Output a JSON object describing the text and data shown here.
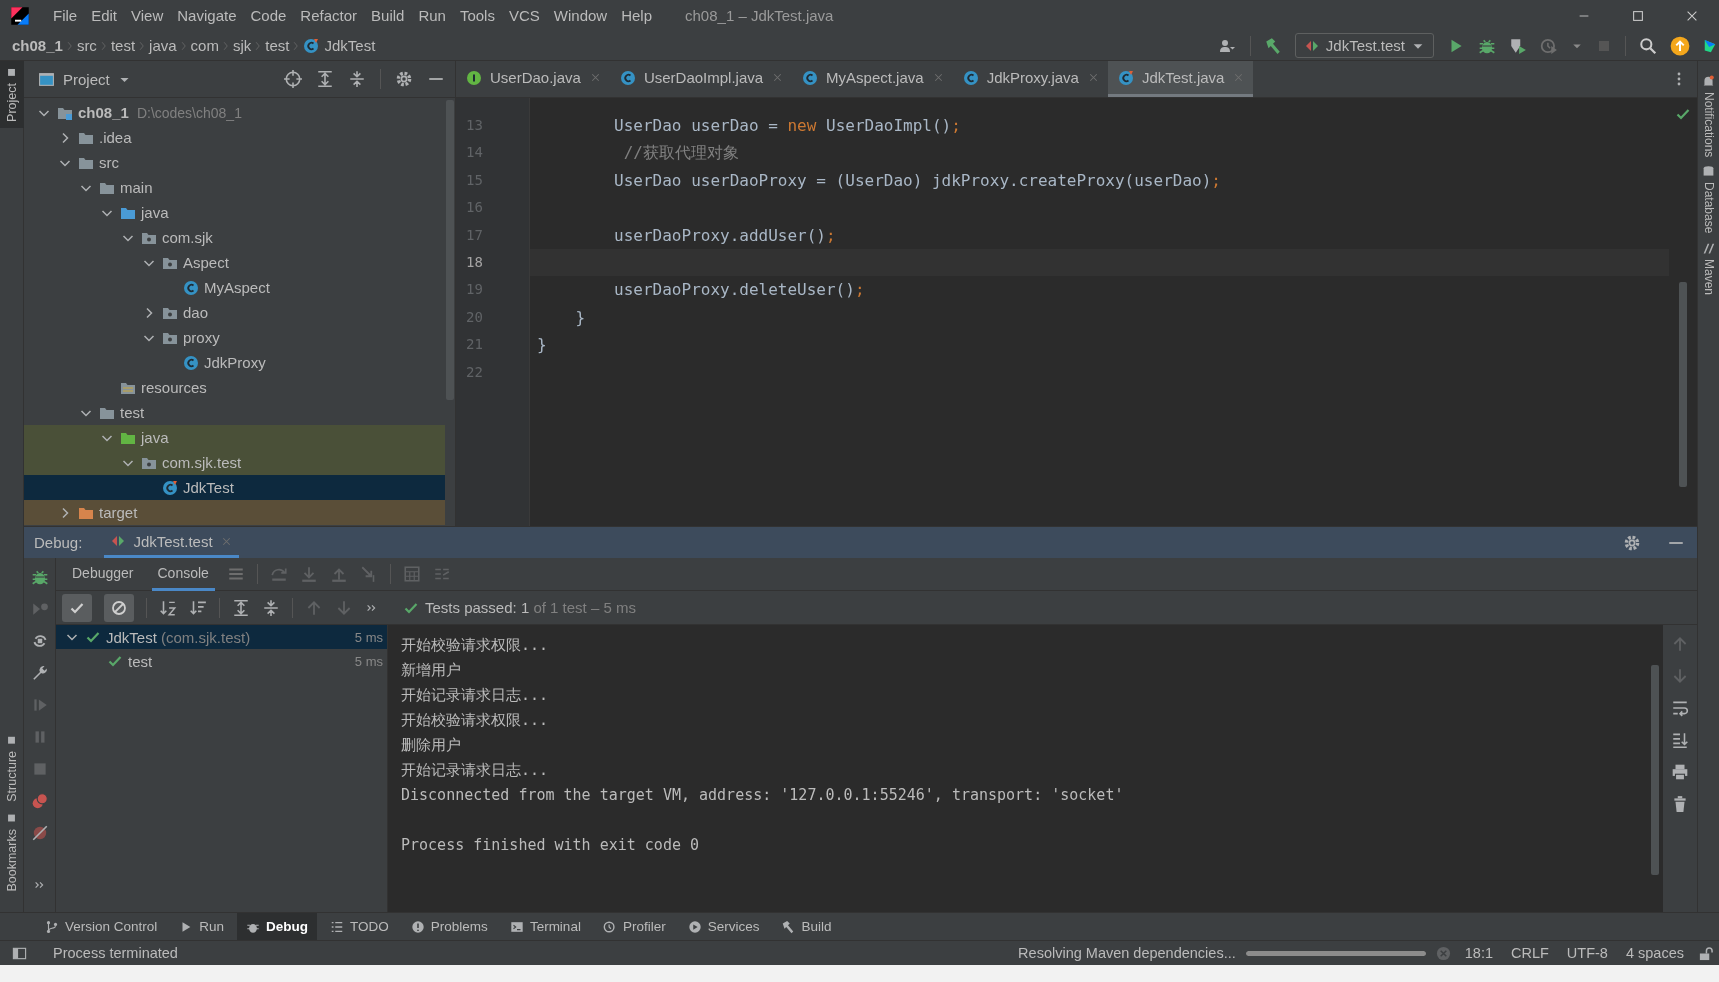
{
  "window": {
    "title": "ch08_1 – JdkTest.java"
  },
  "menu": [
    "File",
    "Edit",
    "View",
    "Navigate",
    "Code",
    "Refactor",
    "Build",
    "Run",
    "Tools",
    "VCS",
    "Window",
    "Help"
  ],
  "breadcrumb": [
    {
      "label": "ch08_1",
      "kind": "project"
    },
    {
      "label": "src",
      "kind": "folder"
    },
    {
      "label": "test",
      "kind": "folder"
    },
    {
      "label": "java",
      "kind": "folder"
    },
    {
      "label": "com",
      "kind": "folder"
    },
    {
      "label": "sjk",
      "kind": "folder"
    },
    {
      "label": "test",
      "kind": "folder"
    },
    {
      "label": "JdkTest",
      "kind": "test-class"
    }
  ],
  "run_config": "JdkTest.test",
  "left_strip": [
    {
      "label": "Project",
      "selected": true
    },
    {
      "label": "Structure",
      "selected": false
    },
    {
      "label": "Bookmarks",
      "selected": false
    }
  ],
  "right_strip": [
    "Notifications",
    "Database",
    "Maven"
  ],
  "project_panel": {
    "title": "Project",
    "tree": [
      {
        "label": "ch08_1",
        "kind": "project",
        "path": "D:\\codes\\ch08_1",
        "expanded": true,
        "selected": false,
        "children": [
          {
            "label": ".idea",
            "kind": "folder",
            "expanded": false,
            "selected": false
          },
          {
            "label": "src",
            "kind": "folder",
            "expanded": true,
            "selected": false,
            "children": [
              {
                "label": "main",
                "kind": "folder",
                "expanded": true,
                "selected": false,
                "children": [
                  {
                    "label": "java",
                    "kind": "source",
                    "expanded": true,
                    "selected": false,
                    "children": [
                      {
                        "label": "com.sjk",
                        "kind": "package",
                        "expanded": true,
                        "selected": false,
                        "children": [
                          {
                            "label": "Aspect",
                            "kind": "package",
                            "expanded": true,
                            "selected": false,
                            "children": [
                              {
                                "label": "MyAspect",
                                "kind": "class",
                                "selected": false
                              }
                            ]
                          },
                          {
                            "label": "dao",
                            "kind": "package",
                            "expanded": false,
                            "selected": false
                          },
                          {
                            "label": "proxy",
                            "kind": "package",
                            "expanded": true,
                            "selected": false,
                            "children": [
                              {
                                "label": "JdkProxy",
                                "kind": "class",
                                "selected": false
                              }
                            ]
                          }
                        ]
                      }
                    ]
                  },
                  {
                    "label": "resources",
                    "kind": "resources",
                    "selected": false
                  }
                ]
              },
              {
                "label": "test",
                "kind": "folder",
                "expanded": true,
                "selected": false,
                "children": [
                  {
                    "label": "java",
                    "kind": "test-source",
                    "color": "#4a5038",
                    "expanded": true,
                    "selected": false,
                    "children": [
                      {
                        "label": "com.sjk.test",
                        "kind": "package",
                        "color": "#4a5038",
                        "expanded": true,
                        "selected": false,
                        "children": [
                          {
                            "label": "JdkTest",
                            "kind": "test-class",
                            "selected": true
                          }
                        ]
                      }
                    ]
                  }
                ]
              }
            ]
          },
          {
            "label": "target",
            "kind": "excluded",
            "color": "#5a4e38",
            "expanded": false,
            "selected": false
          }
        ]
      }
    ]
  },
  "editor_tabs": [
    {
      "label": "UserDao.java",
      "kind": "interface",
      "selected": false
    },
    {
      "label": "UserDaoImpl.java",
      "kind": "class",
      "selected": false
    },
    {
      "label": "MyAspect.java",
      "kind": "class",
      "selected": false
    },
    {
      "label": "JdkProxy.java",
      "kind": "class",
      "selected": false
    },
    {
      "label": "JdkTest.java",
      "kind": "test-class",
      "selected": true
    }
  ],
  "editor": {
    "lines": [
      {
        "number": "13",
        "current": false,
        "segments": [
          {
            "text": "        UserDao userDao = ",
            "kind": "plain"
          },
          {
            "text": "new",
            "kind": "keyword"
          },
          {
            "text": " UserDaoImpl()",
            "kind": "plain"
          },
          {
            "text": ";",
            "kind": "keyword"
          }
        ]
      },
      {
        "number": "14",
        "current": false,
        "segments": [
          {
            "text": "         //获取代理对象",
            "kind": "comment"
          }
        ]
      },
      {
        "number": "15",
        "current": false,
        "segments": [
          {
            "text": "        UserDao userDaoProxy = (UserDao) jdkProxy.createProxy(userDao)",
            "kind": "plain"
          },
          {
            "text": ";",
            "kind": "keyword"
          }
        ]
      },
      {
        "number": "16",
        "current": false
      },
      {
        "number": "17",
        "current": false,
        "segments": [
          {
            "text": "        userDaoProxy.addUser()",
            "kind": "plain"
          },
          {
            "text": ";",
            "kind": "keyword"
          }
        ]
      },
      {
        "number": "18",
        "current": true
      },
      {
        "number": "19",
        "current": false,
        "segments": [
          {
            "text": "        userDaoProxy.deleteUser()",
            "kind": "plain"
          },
          {
            "text": ";",
            "kind": "keyword"
          }
        ]
      },
      {
        "number": "20",
        "current": false,
        "segments": [
          {
            "text": "    }",
            "kind": "plain"
          }
        ]
      },
      {
        "number": "21",
        "current": false,
        "segments": [
          {
            "text": "}",
            "kind": "plain"
          }
        ]
      },
      {
        "number": "22",
        "current": false
      }
    ]
  },
  "debug": {
    "label": "Debug:",
    "tab": "JdkTest.test",
    "subtabs": [
      {
        "label": "Debugger",
        "selected": false
      },
      {
        "label": "Console",
        "selected": true
      }
    ],
    "status": {
      "passed": "Tests passed: 1",
      "detail": "of 1 test – 5 ms"
    },
    "tests": [
      {
        "label": "JdkTest",
        "package": "(com.sjk.test)",
        "time": "5 ms",
        "expanded": true,
        "selected": true,
        "children": [
          {
            "label": "test",
            "time": "5 ms",
            "selected": false
          }
        ]
      }
    ],
    "console": [
      [
        "开始校验请求权限...",
        "新增用户",
        "开始记录请求日志...",
        "开始校验请求权限...",
        "删除用户",
        "开始记录请求日志...",
        "Disconnected from the target VM, address: '127.0.0.1:55246', transport: 'socket'"
      ],
      [
        "Process finished with exit code 0"
      ]
    ]
  },
  "bottom_tools": [
    {
      "label": "Version Control",
      "selected": false
    },
    {
      "label": "Run",
      "selected": false
    },
    {
      "label": "Debug",
      "selected": true
    },
    {
      "label": "TODO",
      "selected": false
    },
    {
      "label": "Problems",
      "selected": false
    },
    {
      "label": "Terminal",
      "selected": false
    },
    {
      "label": "Profiler",
      "selected": false
    },
    {
      "label": "Services",
      "selected": false
    },
    {
      "label": "Build",
      "selected": false
    }
  ],
  "status_bar": {
    "message": "Process terminated",
    "task": "Resolving Maven dependencies...",
    "level": 1,
    "position": "18:1",
    "line_separator": "CRLF",
    "encoding": "UTF-8",
    "indent": "4 spaces"
  }
}
